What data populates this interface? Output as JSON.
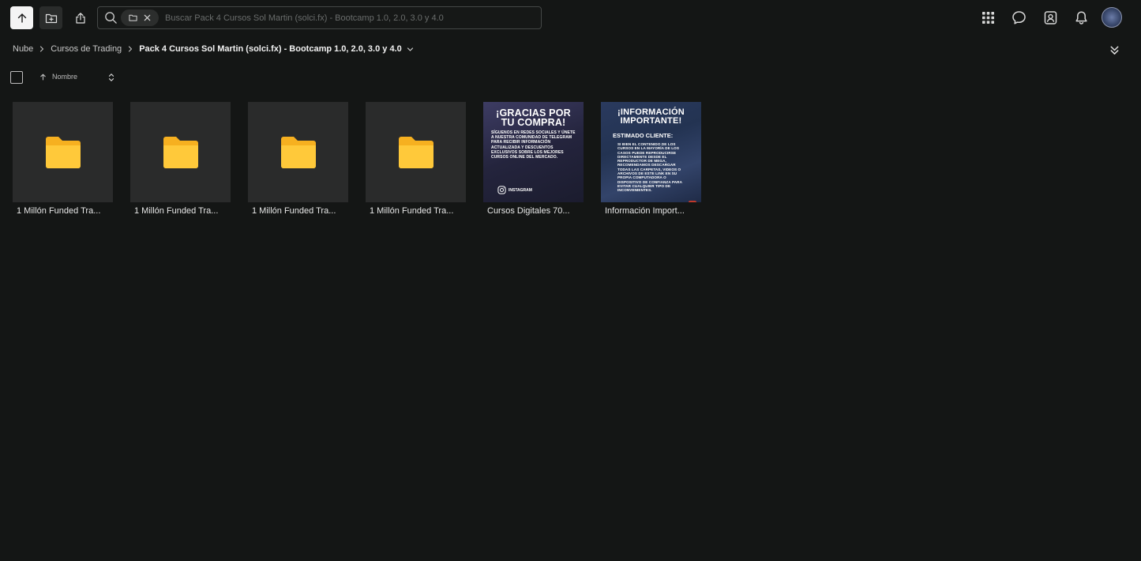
{
  "search": {
    "placeholder": "Buscar Pack 4 Cursos Sol Martin (solci.fx) - Bootcamp 1.0, 2.0, 3.0 y 4.0"
  },
  "breadcrumb": {
    "items": [
      "Nube",
      "Cursos de Trading"
    ],
    "current": "Pack 4 Cursos Sol Martin (solci.fx) - Bootcamp 1.0, 2.0, 3.0 y 4.0"
  },
  "sort": {
    "label": "Nombre"
  },
  "files": [
    {
      "name": "1 Millón Funded Tra...",
      "kind": "folder"
    },
    {
      "name": "1 Millón Funded Tra...",
      "kind": "folder"
    },
    {
      "name": "1 Millón Funded Tra...",
      "kind": "folder"
    },
    {
      "name": "1 Millón Funded Tra...",
      "kind": "folder"
    },
    {
      "name": "Cursos Digitales 70...",
      "kind": "image"
    },
    {
      "name": "Información Import...",
      "kind": "image"
    }
  ],
  "posters": {
    "gracias": {
      "heading_line1": "¡GRACIAS POR",
      "heading_line2": "TU COMPRA!",
      "body": "SÍGUENOS EN REDES SOCIALES Y ÚNETE A NUESTRA COMUNIDAD DE TELEGRAM PARA RECIBIR INFORMACIÓN ACTUALIZADA Y DESCUENTOS EXCLUSIVOS SOBRE LOS MEJORES CURSOS ONLINE DEL MERCADO.",
      "social": "INSTAGRAM"
    },
    "info": {
      "heading_line1": "¡INFORMACIÓN",
      "heading_line2": "IMPORTANTE!",
      "subheading": "ESTIMADO CLIENTE:",
      "body": "SI BIEN EL CONTENIDO DE LOS CURSOS EN LA MAYORÍA DE LOS CASOS PUEDE REPRODUCIRSE DIRECTAMENTE DESDE EL REPRODUCTOR DE MEGA, RECOMENDAMOS DESCARGAR TODAS LAS CARPETAS, VIDEOS O ARCHIVOS DE ESTE LINK EN SU PROPIA COMPUTADORA O DISPOSITIVO DE CONFIANZA PARA EVITAR CUALQUIER TIPO DE INCONVENIENTES."
    }
  },
  "colors": {
    "background": "#141615",
    "tile": "#2a2b2b",
    "folder": "#f6b020",
    "folder_light": "#ffc93a"
  },
  "icons": {
    "up": "arrow-up-icon",
    "new_folder": "folder-plus-icon",
    "upload": "share-upload-icon",
    "search": "search-icon",
    "apps": "apps-grid-icon",
    "chat": "chat-icon",
    "contacts": "contacts-icon",
    "notifications": "bell-icon"
  }
}
